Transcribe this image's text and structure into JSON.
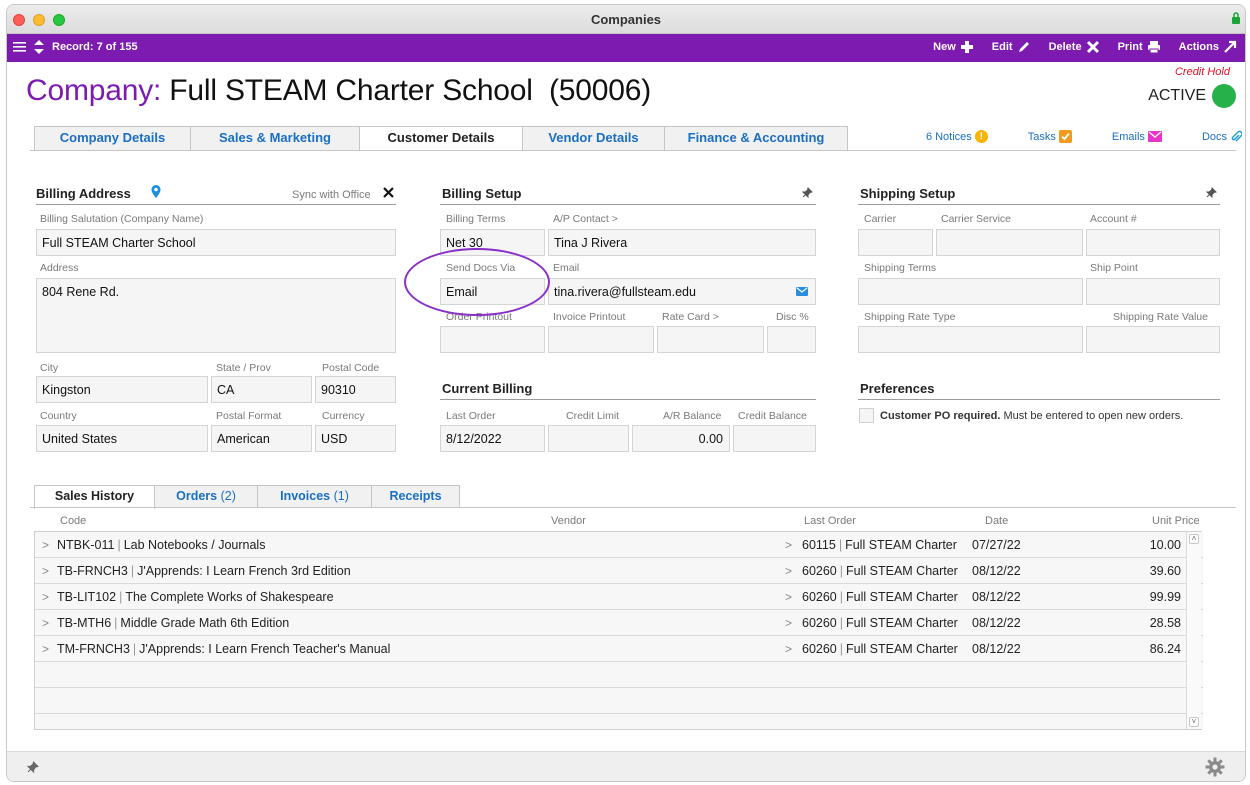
{
  "window": {
    "title": "Companies"
  },
  "toolbar": {
    "record": "Record: 7 of 155",
    "new": "New",
    "edit": "Edit",
    "delete": "Delete",
    "print": "Print",
    "actions": "Actions"
  },
  "header": {
    "label": "Company:",
    "name": "Full STEAM Charter School  (50006)",
    "credit_hold": "Credit Hold",
    "status": "ACTIVE",
    "status_color": "#26b14a"
  },
  "tabs": [
    "Company Details",
    "Sales & Marketing",
    "Customer Details",
    "Vendor Details",
    "Finance & Accounting"
  ],
  "tab_links": {
    "notices": "6 Notices",
    "tasks": "Tasks",
    "emails": "Emails",
    "docs": "Docs"
  },
  "billing_address": {
    "title": "Billing Address",
    "sync": "Sync with Office",
    "salutation_label": "Billing Salutation (Company Name)",
    "salutation": "Full STEAM Charter School",
    "address_label": "Address",
    "address": "804 Rene Rd.",
    "city_label": "City",
    "city": "Kingston",
    "state_label": "State / Prov",
    "state": "CA",
    "postal_label": "Postal Code",
    "postal": "90310",
    "country_label": "Country",
    "country": "United States",
    "postal_format_label": "Postal Format",
    "postal_format": "American",
    "currency_label": "Currency",
    "currency": "USD"
  },
  "billing_setup": {
    "title": "Billing Setup",
    "terms_label": "Billing Terms",
    "terms": "Net 30",
    "ap_label": "A/P Contact >",
    "ap": "Tina J Rivera",
    "send_label": "Send Docs Via",
    "send": "Email",
    "email_label": "Email",
    "email": "tina.rivera@fullsteam.edu",
    "order_printout_label": "Order Printout",
    "invoice_printout_label": "Invoice Printout",
    "rate_card_label": "Rate Card >",
    "disc_label": "Disc %"
  },
  "current_billing": {
    "title": "Current Billing",
    "last_order_label": "Last Order",
    "last_order": "8/12/2022",
    "credit_limit_label": "Credit Limit",
    "ar_label": "A/R Balance",
    "ar": "0.00",
    "credit_balance_label": "Credit Balance"
  },
  "shipping_setup": {
    "title": "Shipping Setup",
    "carrier_label": "Carrier",
    "service_label": "Carrier Service",
    "account_label": "Account #",
    "terms_label": "Shipping Terms",
    "ship_point_label": "Ship Point",
    "rate_type_label": "Shipping Rate Type",
    "rate_value_label": "Shipping Rate Value"
  },
  "preferences": {
    "title": "Preferences",
    "po_bold": "Customer PO required.",
    "po_rest": "Must be entered to open new orders."
  },
  "bottom_tabs": {
    "sales_history": "Sales History",
    "orders": "Orders",
    "orders_count": "(2)",
    "invoices": "Invoices",
    "invoices_count": "(1)",
    "receipts": "Receipts"
  },
  "table": {
    "headers": {
      "code": "Code",
      "vendor": "Vendor",
      "last_order": "Last Order",
      "date": "Date",
      "unit_price": "Unit Price"
    },
    "rows": [
      {
        "code": "NTBK-011",
        "desc": "Lab Notebooks / Journals",
        "order": "60115",
        "vendor": "Full STEAM Charter",
        "date": "07/27/22",
        "price": "10.00"
      },
      {
        "code": "TB-FRNCH3",
        "desc": "J'Apprends: I Learn French 3rd Edition",
        "order": "60260",
        "vendor": "Full STEAM Charter",
        "date": "08/12/22",
        "price": "39.60"
      },
      {
        "code": "TB-LIT102",
        "desc": "The Complete Works of Shakespeare",
        "order": "60260",
        "vendor": "Full STEAM Charter",
        "date": "08/12/22",
        "price": "99.99"
      },
      {
        "code": "TB-MTH6",
        "desc": "Middle Grade Math 6th Edition",
        "order": "60260",
        "vendor": "Full STEAM Charter",
        "date": "08/12/22",
        "price": "28.58"
      },
      {
        "code": "TM-FRNCH3",
        "desc": "J'Apprends: I Learn French Teacher's Manual",
        "order": "60260",
        "vendor": "Full STEAM Charter",
        "date": "08/12/22",
        "price": "86.24"
      }
    ]
  },
  "icons": {
    "menu": "menu-icon",
    "updown": "updown-icon",
    "new": "plus-icon",
    "edit": "pencil-icon",
    "delete": "x-icon",
    "print": "printer-icon",
    "actions": "arrow-out-icon",
    "pin": "pin-icon",
    "gear": "gear-icon",
    "mail": "mail-icon",
    "location": "location-pin-icon"
  }
}
